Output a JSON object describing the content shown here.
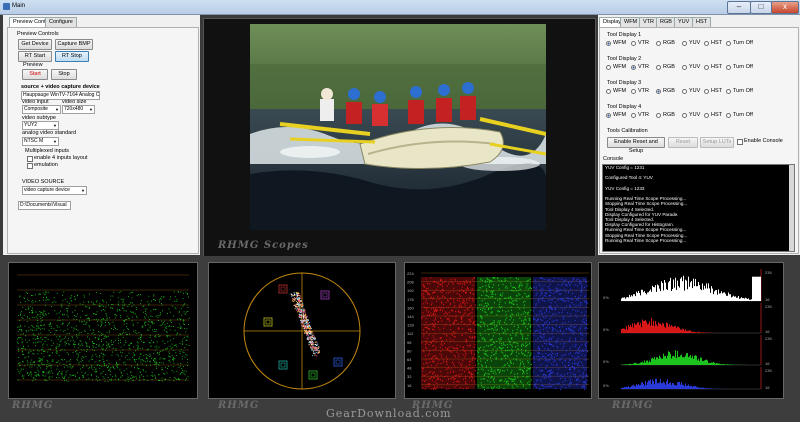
{
  "window": {
    "title": "Main",
    "min": "–",
    "max": "□",
    "close": "x"
  },
  "left": {
    "tabs": [
      "Preview Control",
      "Configure"
    ],
    "preview_controls_label": "Preview Controls",
    "buttons": {
      "get_device": "Get Device",
      "capture_bmp": "Capture BMP",
      "rt_start": "RT Start",
      "rt_stop": "RT Stop",
      "start": "Start",
      "stop": "Stop"
    },
    "preview_label": "Preview",
    "source_label": "source + video capture device",
    "device": "Hauppauge WinTV-7164 Analog C",
    "video_input_label": "video input",
    "video_input": "Composite",
    "video_size_label": "video size",
    "video_size": "720x480",
    "video_subtype_label": "video subtype",
    "video_subtype": "YUY2",
    "analog_standard_label": "analog video standard",
    "analog_standard": "NTSC M",
    "multiplexed_label": "Multiplexed inputs",
    "enable4_label": "enable 4 inputs layout",
    "emulation_label": "emulation",
    "video_source_label": "VIDEO SOURCE",
    "video_source": "video capture device",
    "path": "D:\\Documents\\Visual"
  },
  "video": {
    "watermark": "RHMG Scopes"
  },
  "right": {
    "tabs": [
      "Displays",
      "WFM",
      "VTR",
      "RGB",
      "YUV",
      "HST"
    ],
    "options": [
      "WFM",
      "VTR",
      "RGB",
      "YUV",
      "HST",
      "Turn Off"
    ],
    "tools": [
      {
        "label": "Tool Display 1",
        "selected": 0
      },
      {
        "label": "Tool Display 2",
        "selected": 1
      },
      {
        "label": "Tool Display 3",
        "selected": 2
      },
      {
        "label": "Tool Display 4",
        "selected": 0
      }
    ],
    "calibration_label": "Tools Calibration",
    "calib_buttons": {
      "enable_reset": "Enable Reset and Setup",
      "reset": "Reset",
      "setup_luts": "Setup LUTs"
    },
    "enable_console_label": "Enable Console",
    "console_label": "Console",
    "console_lines": [
      "YUV Config = 1231",
      "",
      "Configured Tool 4: YUV",
      "",
      "YUV Config = 1233",
      "",
      "Running Real Time Scope Processing...",
      "Stopping Real Time Scope Processing...",
      "Tool Display 4 Selected.",
      "Display Configured for YUV Parade.",
      "Tool Display 4 Selected.",
      "Display Configured for Histogram.",
      "Running Real Time Scope Processing...",
      "Stopping Real Time Scope Processing...",
      "Running Real Time Scope Processing..."
    ]
  },
  "scopes": {
    "watermark": "RHMG",
    "parade_labels": [
      "224",
      "208",
      "192",
      "176",
      "160",
      "144",
      "128",
      "112",
      "96",
      "80",
      "64",
      "48",
      "32",
      "16"
    ],
    "hist_labels_right": [
      "235",
      "16",
      "235",
      "16",
      "235",
      "16",
      "235",
      "16"
    ],
    "hist_labels_left": [
      "0%",
      "0%",
      "0%",
      "0%"
    ]
  },
  "site_watermark": "GearDownload.com",
  "colors": {
    "red": "#d81818",
    "green": "#1ec41e",
    "blue": "#2a3ad8",
    "accent": "#3c7fb1"
  }
}
